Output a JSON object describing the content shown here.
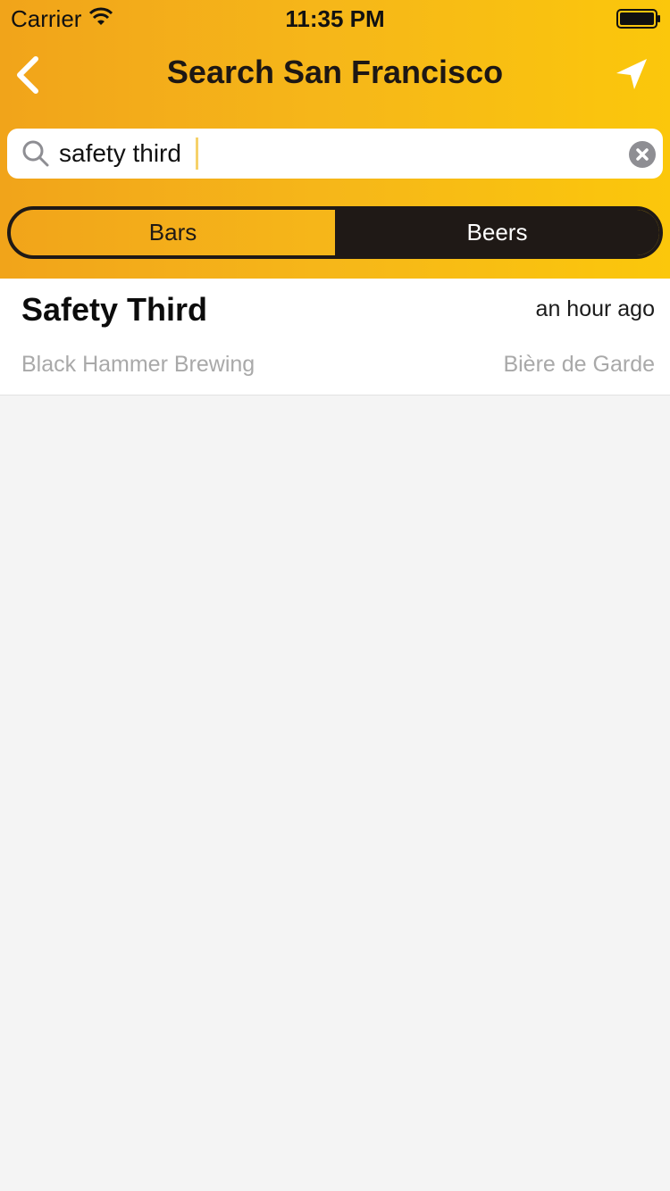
{
  "status_bar": {
    "carrier": "Carrier",
    "time": "11:35 PM"
  },
  "header": {
    "title": "Search San Francisco",
    "back_icon": "chevron-left-icon",
    "location_icon": "location-arrow-icon"
  },
  "search": {
    "value": "safety third",
    "placeholder": ""
  },
  "segments": {
    "bars_label": "Bars",
    "beers_label": "Beers",
    "selected": "Beers"
  },
  "results": [
    {
      "name": "Safety Third",
      "time": "an hour ago",
      "brewery": "Black Hammer Brewing",
      "style": "Bière de Garde"
    }
  ],
  "colors": {
    "header_start": "#f1a41a",
    "header_end": "#fbc70b",
    "dark": "#1f1916",
    "background": "#f4f4f4"
  }
}
